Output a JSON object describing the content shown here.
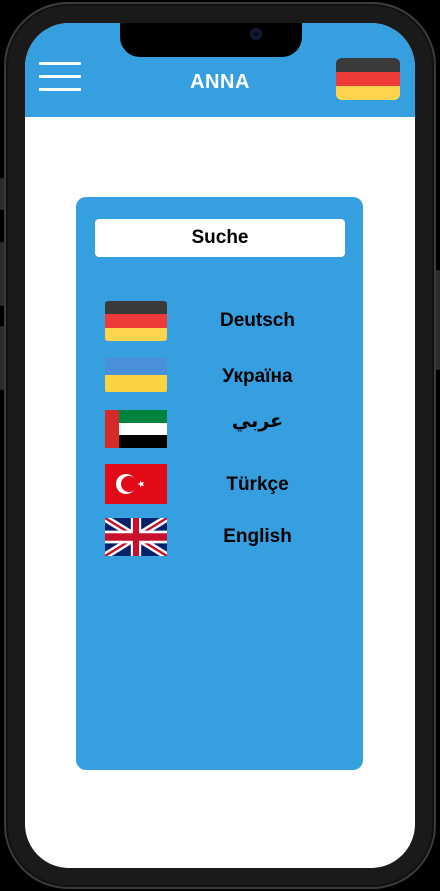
{
  "header": {
    "title": "ANNA",
    "menu_icon": "hamburger-menu-icon",
    "current_language_flag": "germany-flag-icon"
  },
  "search": {
    "placeholder": "Suche",
    "value": ""
  },
  "languages": [
    {
      "label": "Deutsch",
      "flag": "germany-flag-icon"
    },
    {
      "label": "Україна",
      "flag": "ukraine-flag-icon"
    },
    {
      "label": "عربي",
      "flag": "uae-flag-icon"
    },
    {
      "label": "Türkçe",
      "flag": "turkey-flag-icon"
    },
    {
      "label": "English",
      "flag": "uk-flag-icon"
    }
  ],
  "colors": {
    "accent": "#359fdf",
    "background": "#ffffff",
    "text": "#000000"
  }
}
